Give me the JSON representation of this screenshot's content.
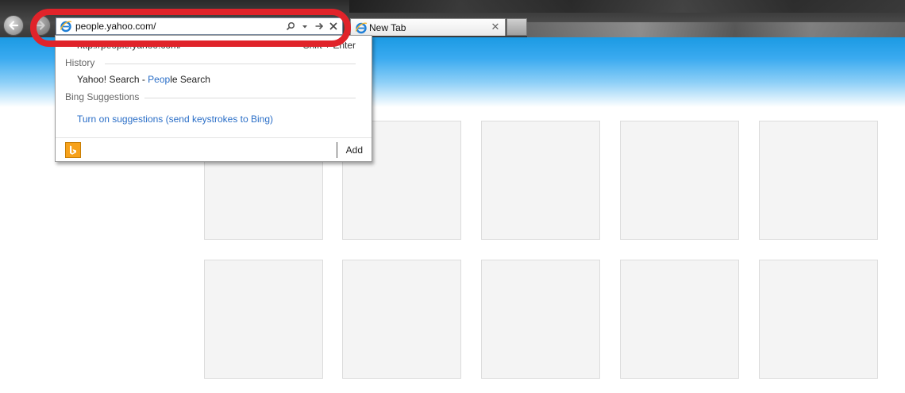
{
  "browser": {
    "address_value": "people.yahoo.com/",
    "tab_title": "New Tab"
  },
  "autocomplete": {
    "url_suggestion": "http://people.yahoo.com/",
    "url_shortcut": "Shift + Enter",
    "history_heading": "History",
    "history_item": {
      "prefix": "Yahoo! Search - ",
      "highlight": "Peop",
      "suffix": "le Search"
    },
    "bing_heading": "Bing Suggestions",
    "turn_on_link": "Turn on suggestions (send keystrokes to Bing)",
    "add_label": "Add"
  },
  "colors": {
    "annotation_ring": "#e0232a",
    "link_blue": "#2a6ec7",
    "header_blue": "#1b9ae3",
    "bing_orange": "#f7a21b"
  },
  "icons": [
    "back-arrow-icon",
    "forward-arrow-icon",
    "ie-logo-icon",
    "search-icon",
    "dropdown-arrow-icon",
    "go-arrow-icon",
    "close-icon",
    "bing-icon"
  ]
}
